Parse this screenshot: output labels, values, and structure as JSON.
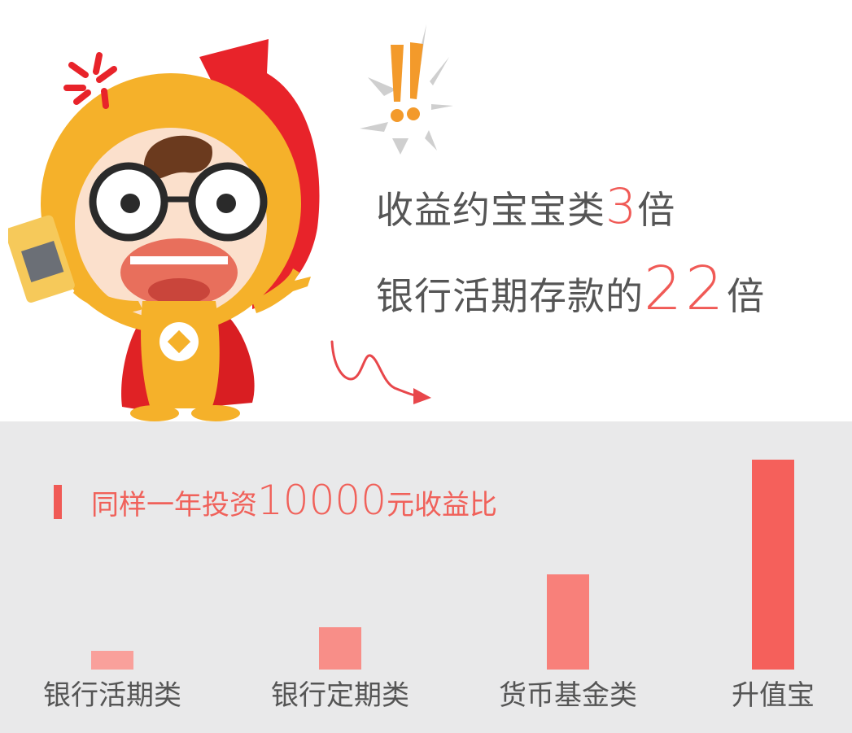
{
  "headline": {
    "line1_prefix": "收益约宝宝类",
    "line1_number": "3",
    "line1_suffix": "倍",
    "line2_prefix": "银行活期存款的",
    "line2_number": "22",
    "line2_suffix": "倍"
  },
  "comparison": {
    "title_prefix": "同样一年投资",
    "title_amount": "10000",
    "title_suffix": "元收益比"
  },
  "chart_data": {
    "type": "bar",
    "categories": [
      "银行活期类",
      "银行定期类",
      "货币基金类",
      "升值宝"
    ],
    "values": [
      1,
      2.2,
      5,
      11
    ],
    "title": "同样一年投资10000元收益比",
    "xlabel": "",
    "ylabel": "",
    "grid": false,
    "legend": "none",
    "colors": [
      "#f9a09b",
      "#f88e88",
      "#f8807a",
      "#f5605b"
    ]
  },
  "colors": {
    "accent": "#f05a56",
    "text": "#555555",
    "panel": "#e9e9ea"
  }
}
